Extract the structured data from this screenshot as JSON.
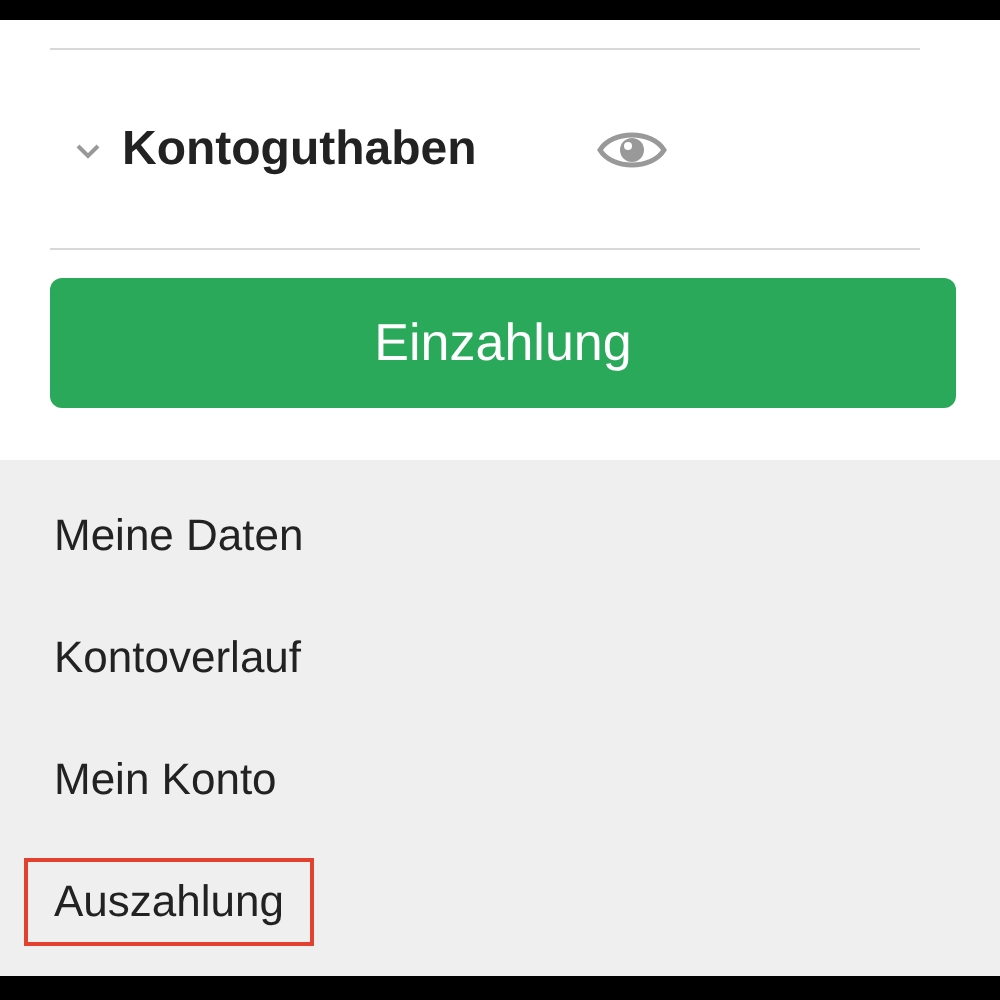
{
  "balance": {
    "label": "Kontoguthaben",
    "expanded": false
  },
  "deposit_button": {
    "label": "Einzahlung"
  },
  "menu": [
    {
      "label": "Meine Daten",
      "highlighted": false
    },
    {
      "label": "Kontoverlauf",
      "highlighted": false
    },
    {
      "label": "Mein Konto",
      "highlighted": false
    },
    {
      "label": "Auszahlung",
      "highlighted": true
    }
  ]
}
